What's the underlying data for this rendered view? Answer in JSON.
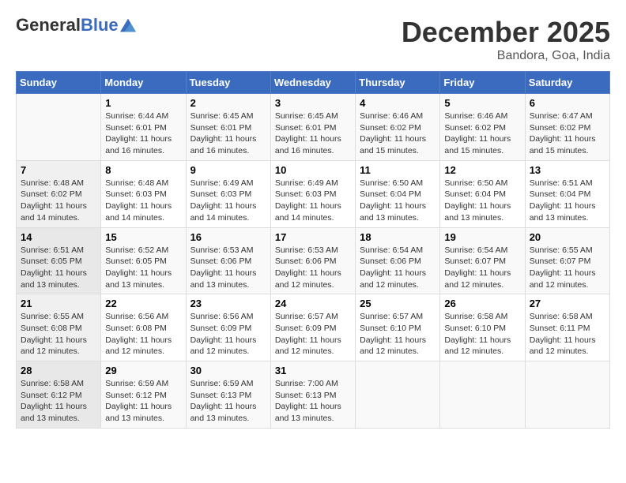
{
  "logo": {
    "general": "General",
    "blue": "Blue"
  },
  "title": "December 2025",
  "location": "Bandora, Goa, India",
  "days_of_week": [
    "Sunday",
    "Monday",
    "Tuesday",
    "Wednesday",
    "Thursday",
    "Friday",
    "Saturday"
  ],
  "weeks": [
    [
      {
        "num": "",
        "info": ""
      },
      {
        "num": "1",
        "info": "Sunrise: 6:44 AM\nSunset: 6:01 PM\nDaylight: 11 hours and 16 minutes."
      },
      {
        "num": "2",
        "info": "Sunrise: 6:45 AM\nSunset: 6:01 PM\nDaylight: 11 hours and 16 minutes."
      },
      {
        "num": "3",
        "info": "Sunrise: 6:45 AM\nSunset: 6:01 PM\nDaylight: 11 hours and 16 minutes."
      },
      {
        "num": "4",
        "info": "Sunrise: 6:46 AM\nSunset: 6:02 PM\nDaylight: 11 hours and 15 minutes."
      },
      {
        "num": "5",
        "info": "Sunrise: 6:46 AM\nSunset: 6:02 PM\nDaylight: 11 hours and 15 minutes."
      },
      {
        "num": "6",
        "info": "Sunrise: 6:47 AM\nSunset: 6:02 PM\nDaylight: 11 hours and 15 minutes."
      }
    ],
    [
      {
        "num": "7",
        "info": "Sunrise: 6:48 AM\nSunset: 6:02 PM\nDaylight: 11 hours and 14 minutes."
      },
      {
        "num": "8",
        "info": "Sunrise: 6:48 AM\nSunset: 6:03 PM\nDaylight: 11 hours and 14 minutes."
      },
      {
        "num": "9",
        "info": "Sunrise: 6:49 AM\nSunset: 6:03 PM\nDaylight: 11 hours and 14 minutes."
      },
      {
        "num": "10",
        "info": "Sunrise: 6:49 AM\nSunset: 6:03 PM\nDaylight: 11 hours and 14 minutes."
      },
      {
        "num": "11",
        "info": "Sunrise: 6:50 AM\nSunset: 6:04 PM\nDaylight: 11 hours and 13 minutes."
      },
      {
        "num": "12",
        "info": "Sunrise: 6:50 AM\nSunset: 6:04 PM\nDaylight: 11 hours and 13 minutes."
      },
      {
        "num": "13",
        "info": "Sunrise: 6:51 AM\nSunset: 6:04 PM\nDaylight: 11 hours and 13 minutes."
      }
    ],
    [
      {
        "num": "14",
        "info": "Sunrise: 6:51 AM\nSunset: 6:05 PM\nDaylight: 11 hours and 13 minutes."
      },
      {
        "num": "15",
        "info": "Sunrise: 6:52 AM\nSunset: 6:05 PM\nDaylight: 11 hours and 13 minutes."
      },
      {
        "num": "16",
        "info": "Sunrise: 6:53 AM\nSunset: 6:06 PM\nDaylight: 11 hours and 13 minutes."
      },
      {
        "num": "17",
        "info": "Sunrise: 6:53 AM\nSunset: 6:06 PM\nDaylight: 11 hours and 12 minutes."
      },
      {
        "num": "18",
        "info": "Sunrise: 6:54 AM\nSunset: 6:06 PM\nDaylight: 11 hours and 12 minutes."
      },
      {
        "num": "19",
        "info": "Sunrise: 6:54 AM\nSunset: 6:07 PM\nDaylight: 11 hours and 12 minutes."
      },
      {
        "num": "20",
        "info": "Sunrise: 6:55 AM\nSunset: 6:07 PM\nDaylight: 11 hours and 12 minutes."
      }
    ],
    [
      {
        "num": "21",
        "info": "Sunrise: 6:55 AM\nSunset: 6:08 PM\nDaylight: 11 hours and 12 minutes."
      },
      {
        "num": "22",
        "info": "Sunrise: 6:56 AM\nSunset: 6:08 PM\nDaylight: 11 hours and 12 minutes."
      },
      {
        "num": "23",
        "info": "Sunrise: 6:56 AM\nSunset: 6:09 PM\nDaylight: 11 hours and 12 minutes."
      },
      {
        "num": "24",
        "info": "Sunrise: 6:57 AM\nSunset: 6:09 PM\nDaylight: 11 hours and 12 minutes."
      },
      {
        "num": "25",
        "info": "Sunrise: 6:57 AM\nSunset: 6:10 PM\nDaylight: 11 hours and 12 minutes."
      },
      {
        "num": "26",
        "info": "Sunrise: 6:58 AM\nSunset: 6:10 PM\nDaylight: 11 hours and 12 minutes."
      },
      {
        "num": "27",
        "info": "Sunrise: 6:58 AM\nSunset: 6:11 PM\nDaylight: 11 hours and 12 minutes."
      }
    ],
    [
      {
        "num": "28",
        "info": "Sunrise: 6:58 AM\nSunset: 6:12 PM\nDaylight: 11 hours and 13 minutes."
      },
      {
        "num": "29",
        "info": "Sunrise: 6:59 AM\nSunset: 6:12 PM\nDaylight: 11 hours and 13 minutes."
      },
      {
        "num": "30",
        "info": "Sunrise: 6:59 AM\nSunset: 6:13 PM\nDaylight: 11 hours and 13 minutes."
      },
      {
        "num": "31",
        "info": "Sunrise: 7:00 AM\nSunset: 6:13 PM\nDaylight: 11 hours and 13 minutes."
      },
      {
        "num": "",
        "info": ""
      },
      {
        "num": "",
        "info": ""
      },
      {
        "num": "",
        "info": ""
      }
    ]
  ]
}
